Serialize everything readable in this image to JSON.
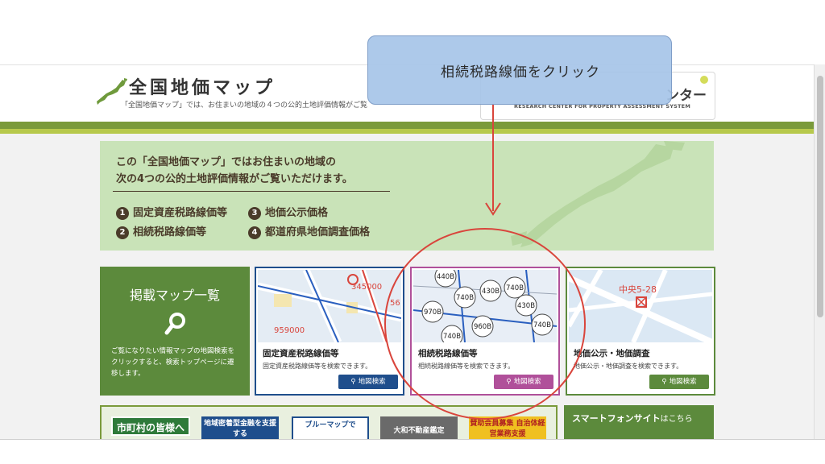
{
  "header": {
    "title": "全国地価マップ",
    "subtitle": "「全国地価マップ」では、お住まいの地域の４つの公的土地評価情報がご覧",
    "org_name_ja": "ンター",
    "org_name_en": "RESEARCH CENTER FOR PROPERTY ASSESSMENT SYSTEM"
  },
  "banner": {
    "line1": "この「全国地価マップ」ではお住まいの地域の",
    "line2": "次の4つの公的土地評価情報がご覧いただけます。",
    "items": [
      {
        "num": "1",
        "label": "固定資産税路線価等"
      },
      {
        "num": "2",
        "label": "相続税路線価等"
      },
      {
        "num": "3",
        "label": "地価公示価格"
      },
      {
        "num": "4",
        "label": "都道府県地価調査価格"
      }
    ]
  },
  "map_list_card": {
    "title": "掲載マップ一覧",
    "description": "ご覧になりたい情報マップの地図検索をクリックすると、検索トップページに遷移します。"
  },
  "cards": [
    {
      "title": "固定資産税路線価等",
      "description": "固定資産税路線価等を検索できます。",
      "button": "地図検索",
      "map_labels": [
        "345000",
        "959000",
        "56"
      ],
      "color": "#1f4e8c"
    },
    {
      "title": "相続税路線価等",
      "description": "相続税路線価等を検索できます。",
      "button": "地図検索",
      "map_labels": [
        "440B",
        "430B",
        "740B",
        "970B",
        "740B",
        "430B",
        "960B",
        "740B",
        "740B"
      ],
      "color": "#b0509a"
    },
    {
      "title": "地価公示・地価調査",
      "description": "地価公示・地価調査を検索できます。",
      "button": "地図検索",
      "map_labels": [
        "中央5-28"
      ],
      "color": "#5c8a3c"
    }
  ],
  "bottom": {
    "municipality_label": "市町村の皆様へ",
    "banners": [
      {
        "text": "地域密着型金融を支援する"
      },
      {
        "text": "ブルーマップで"
      },
      {
        "text": "大和不動産鑑定"
      },
      {
        "text": "賛助会員募集 自治体経営業務支援"
      }
    ],
    "smartphone": {
      "main": "スマートフォンサイト",
      "suffix": "はこちら"
    }
  },
  "annotation": {
    "text": "相続税路線価をクリック"
  },
  "colors": {
    "header_green": "#7a9a3b",
    "header_lime": "#b7c94c",
    "banner_bg": "#c9e3b8",
    "card1_border": "#1f4e8c",
    "card2_border": "#b0509a",
    "card3_border": "#5c8a3c",
    "annotation_red": "#d9453c",
    "overlay_blue": "#a6c4e8"
  }
}
